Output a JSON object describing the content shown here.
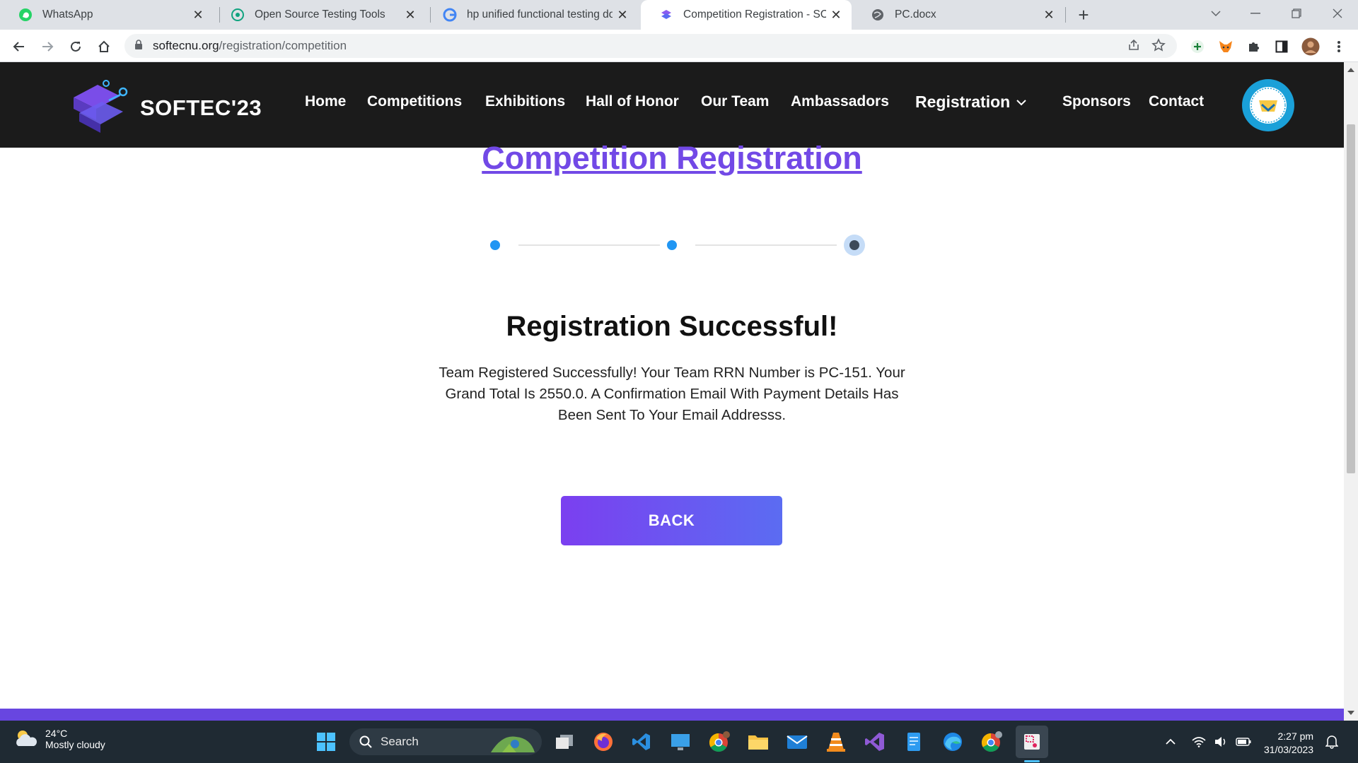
{
  "browser": {
    "tabs": [
      {
        "title": "WhatsApp",
        "icon": "whatsapp-icon",
        "active": false
      },
      {
        "title": "Open Source Testing Tools",
        "icon": "openai-icon",
        "active": false
      },
      {
        "title": "hp unified functional testing dow",
        "icon": "google-icon",
        "active": false
      },
      {
        "title": "Competition Registration - SOFTE",
        "icon": "softec-icon",
        "active": true
      },
      {
        "title": "PC.docx",
        "icon": "globe-icon",
        "active": false
      }
    ],
    "url_domain": "softecnu.org",
    "url_path": "/registration/competition"
  },
  "site": {
    "logo_text": "SOFTEC'23",
    "nav": [
      "Home",
      "Competitions",
      "Exhibitions",
      "Hall of Honor",
      "Our Team",
      "Ambassadors",
      "Registration",
      "Sponsors",
      "Contact"
    ]
  },
  "main": {
    "page_title": "Competition Registration",
    "stepper": {
      "total_steps": 3,
      "current_step": 3
    },
    "success_title": "Registration Successful!",
    "success_message": "Team Registered Successfully! Your Team RRN Number is PC-151. Your Grand Total Is 2550.0. A Confirmation Email With Payment Details Has Been Sent To Your Email Addresss.",
    "back_label": "BACK"
  },
  "taskbar": {
    "weather_temp": "24°C",
    "weather_condition": "Mostly cloudy",
    "search_label": "Search",
    "time": "2:27 pm",
    "date": "31/03/2023"
  },
  "colors": {
    "accent_purple": "#7249e6",
    "header_bg": "#1b1b1b",
    "step_blue": "#2196f3",
    "button_gradient_start": "#7b3ff0",
    "button_gradient_end": "#5b6cf2"
  }
}
